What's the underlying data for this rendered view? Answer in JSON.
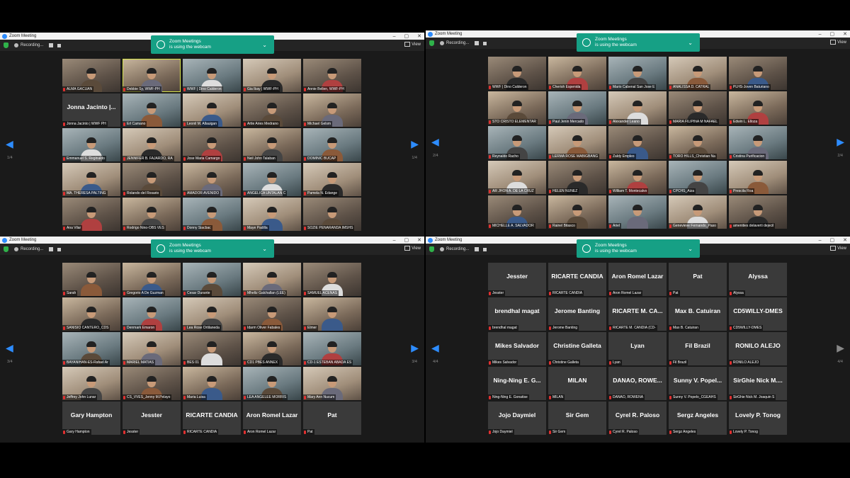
{
  "common": {
    "title": "Zoom Meeting",
    "recording_label": "Recording...",
    "view_label": "View",
    "notif_line1": "Zoom Meetings",
    "notif_line2": "is using the webcam",
    "controls": [
      "–",
      "▢",
      "✕"
    ]
  },
  "colors": {
    "accent": "#2d8cff",
    "notif_bg": "#16a085",
    "mic_muted": "#e03030",
    "highlight": "#d6e24a"
  },
  "windows": [
    {
      "page_left": "1/4",
      "page_right": "1/4",
      "participants": [
        {
          "name": "ALMA GACUAN",
          "video": true
        },
        {
          "name": "Debbie Sy, WWF-PH",
          "video": true,
          "highlight": true
        },
        {
          "name": "WWF | Dino Calderon",
          "video": true
        },
        {
          "name": "Gia Ibay | WWF-PH",
          "video": true
        },
        {
          "name": "Annie Bellen, WWF-PH",
          "video": true
        },
        {
          "name": "Jonna Jacinto | WWF PH",
          "big": "Jonna Jacinto |...",
          "video": false
        },
        {
          "name": "Erl Camano",
          "video": true
        },
        {
          "name": "Leonil M. Allauigan",
          "video": true
        },
        {
          "name": "Artie Aries Medrano",
          "video": true
        },
        {
          "name": "Michael Gelsm",
          "video": true
        },
        {
          "name": "Emmanuel S. Reginaldo",
          "video": true
        },
        {
          "name": "JENNIFER B. FAJARDO, RA",
          "video": true
        },
        {
          "name": "Jose Maria Camargo",
          "video": true
        },
        {
          "name": "Neil John Talaban",
          "video": true
        },
        {
          "name": "DOMINIC BUCAP",
          "video": true
        },
        {
          "name": "MA. THERESA PALTING",
          "video": true
        },
        {
          "name": "Rolando del Rosario",
          "video": true
        },
        {
          "name": "AMADOR AVENIDO",
          "video": true
        },
        {
          "name": "ANGELICA UNTALAN C",
          "video": true
        },
        {
          "name": "Pamela N. Edange",
          "video": true
        },
        {
          "name": "Ana Vilar",
          "video": true
        },
        {
          "name": "Rodrigo Nino-OBS VES",
          "video": true
        },
        {
          "name": "Donny Siacbac",
          "video": true
        },
        {
          "name": "Maye Padilla",
          "video": true
        },
        {
          "name": "SOZIE PENARANDA IMSHS",
          "video": true
        }
      ]
    },
    {
      "page_left": "2/4",
      "page_right": "2/4",
      "participants": [
        {
          "name": "WWF | Dino Calderon",
          "video": true
        },
        {
          "name": "Cherish Espenida",
          "video": true
        },
        {
          "name": "Mario Cabenal San Jose E",
          "video": true
        },
        {
          "name": "ANALISSA D. CATRAL",
          "video": true
        },
        {
          "name": "PLHS-Joven Baturiano",
          "video": true
        },
        {
          "name": "STO CRISTO ELEMENTAR",
          "video": true
        },
        {
          "name": "Paul Jenin Mercado",
          "video": true
        },
        {
          "name": "Alexander Leano",
          "video": true
        },
        {
          "name": "MARIA FILIPINA M NAFAEL",
          "video": true
        },
        {
          "name": "Edwin L. Elloza",
          "video": true
        },
        {
          "name": "Reynaldo Racho",
          "video": true
        },
        {
          "name": "LERMA ROSE MABIGBANG",
          "video": true
        },
        {
          "name": "Zaldy Empleo",
          "video": true
        },
        {
          "name": "TORO HILLS_Christian Na",
          "video": true
        },
        {
          "name": "Cristina Purificacion",
          "video": true
        },
        {
          "name": "AR JHON A. DE LA CRUZ",
          "video": true
        },
        {
          "name": "HELEN NUNEZ",
          "video": true
        },
        {
          "name": "William T. Montecalvo",
          "video": true
        },
        {
          "name": "CPCHS_Aiza",
          "video": true
        },
        {
          "name": "Prescila Roa",
          "video": true
        },
        {
          "name": "MICHELLE A. SALVADOR",
          "video": true
        },
        {
          "name": "Rainel Bitasco",
          "video": true
        },
        {
          "name": "Ariel",
          "video": true
        },
        {
          "name": "Genevieve Fernando_Paso",
          "video": true
        },
        {
          "name": "amenities delaverti dejecil",
          "video": true
        }
      ]
    },
    {
      "page_left": "3/4",
      "page_right": "3/4",
      "participants": [
        {
          "name": "Sarah",
          "video": true
        },
        {
          "name": "Gregorio A De Guzman",
          "video": true
        },
        {
          "name": "Cesar Durante",
          "video": true
        },
        {
          "name": "Mheltz Galchallan (LEE)",
          "video": true
        },
        {
          "name": "SAMUEL ACENAS",
          "video": true
        },
        {
          "name": "SANISIO CANTERO_CDS",
          "video": true
        },
        {
          "name": "Denmark Emaron",
          "video": true
        },
        {
          "name": "Lea Rose Ortilaneda",
          "video": true
        },
        {
          "name": "Idarm Oliver Fabales",
          "video": true
        },
        {
          "name": "Elmer",
          "video": true
        },
        {
          "name": "BAYANIHAN-ES-Rafael Ar",
          "video": true
        },
        {
          "name": "MARIEL MATIAS",
          "video": true
        },
        {
          "name": "BES 01",
          "video": true
        },
        {
          "name": "CD1 PBES ANNEX",
          "video": true
        },
        {
          "name": "CD-1 ESTEBAN ABADA ES",
          "video": true
        },
        {
          "name": "Jeffrey John Lunar",
          "video": true
        },
        {
          "name": "CS_VVES_Jenny M.Pelayo",
          "video": true
        },
        {
          "name": "Maria Luisa",
          "video": true
        },
        {
          "name": "LEA ANGELEE MORRIS",
          "video": true
        },
        {
          "name": "Mary Ann Nucum",
          "video": true
        },
        {
          "name": "Gary Hampton",
          "big": "Gary Hampton",
          "video": false
        },
        {
          "name": "Jesster",
          "big": "Jesster",
          "video": false
        },
        {
          "name": "RICARTE CANDIA",
          "big": "RICARTE CANDIA",
          "video": false
        },
        {
          "name": "Aron Romel Lazar",
          "big": "Aron Romel Lazar",
          "video": false
        },
        {
          "name": "Pat",
          "big": "Pat",
          "video": false
        }
      ]
    },
    {
      "page_left": "4/4",
      "page_right": "4/4",
      "right_disabled": true,
      "participants": [
        {
          "name": "Jesster",
          "big": "Jesster",
          "video": false
        },
        {
          "name": "RICARTE CANDIA",
          "big": "RICARTE CANDIA",
          "video": false
        },
        {
          "name": "Aron Romel Lazar",
          "big": "Aron Romel Lazar",
          "video": false
        },
        {
          "name": "Pat",
          "big": "Pat",
          "video": false
        },
        {
          "name": "Alyssa",
          "big": "Alyssa",
          "video": false
        },
        {
          "name": "brendhal magat",
          "big": "brendhal magat",
          "video": false
        },
        {
          "name": "Jerome Banting",
          "big": "Jerome Banting",
          "video": false
        },
        {
          "name": "RICARTE M. CANDIA (CD-",
          "big": "RICARTE M. CA...",
          "video": false
        },
        {
          "name": "Max B. Catuiran",
          "big": "Max B. Catuiran",
          "video": false
        },
        {
          "name": "CD5WILLY-DMES",
          "big": "CD5WILLY-DMES",
          "video": false
        },
        {
          "name": "Mikes Salvador",
          "big": "Mikes Salvador",
          "video": false
        },
        {
          "name": "Christine Galleta",
          "big": "Christine Galleta",
          "video": false
        },
        {
          "name": "Lyan",
          "big": "Lyan",
          "video": false
        },
        {
          "name": "Fil Brazil",
          "big": "Fil Brazil",
          "video": false
        },
        {
          "name": "RONILO ALEJO",
          "big": "RONILO ALEJO",
          "video": false
        },
        {
          "name": "Ning-Ning E. Gonatise",
          "big": "Ning-Ning E. G...",
          "video": false
        },
        {
          "name": "MILAN",
          "big": "MILAN",
          "video": false
        },
        {
          "name": "DANAO, ROWENA",
          "big": "DANAO, ROWE...",
          "video": false
        },
        {
          "name": "Sunny V. Popelo_CGEAHS",
          "big": "Sunny V. Popel...",
          "video": false
        },
        {
          "name": "SirGhie Nick M. Joaquin S",
          "big": "SirGhie Nick M....",
          "video": false
        },
        {
          "name": "Jojo Daymiel",
          "big": "Jojo Daymiel",
          "video": false
        },
        {
          "name": "Sir Gem",
          "big": "Sir Gem",
          "video": false
        },
        {
          "name": "Cyrel R. Paloso",
          "big": "Cyrel R. Paloso",
          "video": false
        },
        {
          "name": "Sergz Angeles",
          "big": "Sergz Angeles",
          "video": false
        },
        {
          "name": "Lovely P. Tonog",
          "big": "Lovely P. Tonog",
          "video": false
        }
      ]
    }
  ]
}
